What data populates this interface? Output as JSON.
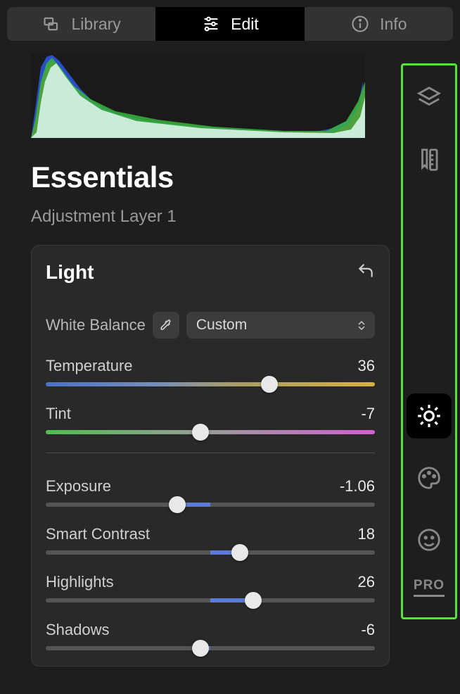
{
  "tabs": {
    "library": "Library",
    "edit": "Edit",
    "info": "Info"
  },
  "title": "Essentials",
  "subtitle": "Adjustment Layer 1",
  "panel": {
    "title": "Light",
    "white_balance": {
      "label": "White Balance",
      "mode": "Custom"
    },
    "sliders": {
      "temperature": {
        "label": "Temperature",
        "value": "36",
        "pct": 68
      },
      "tint": {
        "label": "Tint",
        "value": "-7",
        "pct": 47
      },
      "exposure": {
        "label": "Exposure",
        "value": "-1.06",
        "pct": 40,
        "fill_center": true
      },
      "contrast": {
        "label": "Smart Contrast",
        "value": "18",
        "pct": 59,
        "fill_center": true
      },
      "highlights": {
        "label": "Highlights",
        "value": "26",
        "pct": 63,
        "fill_center": true
      },
      "shadows": {
        "label": "Shadows",
        "value": "-6",
        "pct": 47,
        "fill_center": true
      }
    }
  },
  "rail": {
    "pro": "PRO"
  }
}
